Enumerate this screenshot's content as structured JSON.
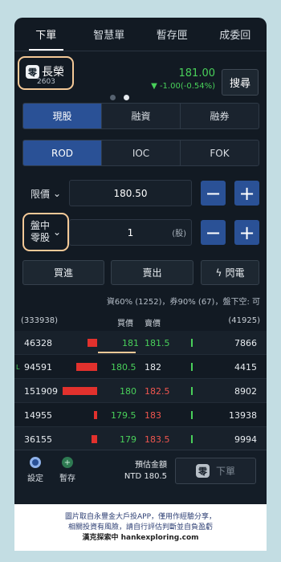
{
  "tabs": [
    "下單",
    "智慧單",
    "暫存匣",
    "成委回"
  ],
  "stock": {
    "logo": "零",
    "name": "長榮",
    "code": "2603",
    "price": "181.00",
    "change": "▼ -1.00(-0.54%)",
    "search": "搜尋"
  },
  "trade_type": [
    "現股",
    "融資",
    "融券"
  ],
  "order_type": [
    "ROD",
    "IOC",
    "FOK"
  ],
  "price_row": {
    "label": "限價",
    "value": "180.50"
  },
  "qty_row": {
    "label": "盤中\n零股",
    "value": "1",
    "unit": "(股)"
  },
  "actions": {
    "buy": "買進",
    "sell": "賣出",
    "flash": "閃電"
  },
  "info": "資60% (1252)，券90% (67)，盤下空: 可",
  "book_head": {
    "left": "(333938)",
    "bid": "買價",
    "ask": "賣價",
    "right": "(41925)"
  },
  "book": [
    {
      "bid_qty": "46328",
      "bid": "181",
      "ask": "181.5",
      "ask_qty": "7866"
    },
    {
      "bid_qty": "94591",
      "bid": "180.5",
      "ask": "182",
      "ask_qty": "4415"
    },
    {
      "bid_qty": "151909",
      "bid": "180",
      "ask": "182.5",
      "ask_qty": "8902"
    },
    {
      "bid_qty": "14955",
      "bid": "179.5",
      "ask": "183",
      "ask_qty": "13938"
    },
    {
      "bid_qty": "36155",
      "bid": "179",
      "ask": "183.5",
      "ask_qty": "9994"
    }
  ],
  "bottom": {
    "settings": "設定",
    "save": "暫存",
    "estimate": "預估金額",
    "estimate_value": "NTD 180.5",
    "order": "下單",
    "order_logo": "零"
  },
  "footer": {
    "line1": "圖片取自永豐金大戶投APP，僅用作經驗分享，",
    "line2": "相關投資有風險，請自行評估判斷並自負盈虧",
    "line3": "漢克探索中 hankexploring.com"
  },
  "colors": {
    "accent": "#2a5196",
    "up_green": "#49d05a",
    "down_red": "#e2312d"
  }
}
